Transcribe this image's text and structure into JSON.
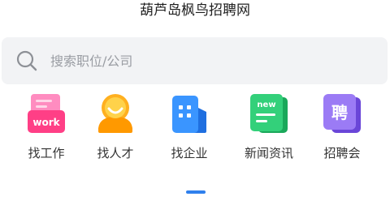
{
  "header": {
    "title": "葫芦岛枫鸟招聘网"
  },
  "search": {
    "placeholder": "搜索职位/公司",
    "icon": "search-icon"
  },
  "nav": {
    "items": [
      {
        "label": "找工作",
        "icon": "work-briefcase-icon",
        "badge": "work",
        "color": "#ff4f91"
      },
      {
        "label": "找人才",
        "icon": "talent-person-icon",
        "color": "#ffa010"
      },
      {
        "label": "找企业",
        "icon": "company-building-icon",
        "color": "#2b88ff"
      },
      {
        "label": "新闻资讯",
        "icon": "news-icon",
        "badge": "new",
        "color": "#22c46a"
      },
      {
        "label": "招聘会",
        "icon": "job-fair-icon",
        "badge": "聘",
        "color": "#8a63ee"
      }
    ]
  },
  "pager": {
    "active_color": "#2f80ed"
  }
}
